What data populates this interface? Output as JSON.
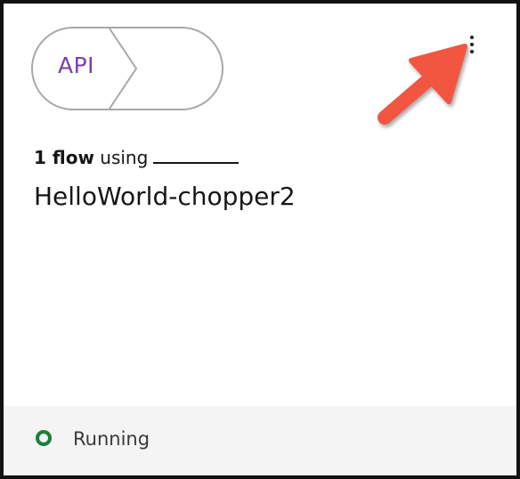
{
  "connector": {
    "label": "API"
  },
  "menu": {
    "icon": "overflow-menu-vertical-icon"
  },
  "annotation": {
    "icon": "arrow-pointer-icon",
    "color": "#f2553f"
  },
  "flow": {
    "count_label": "1 flow",
    "using_label": "using"
  },
  "integration": {
    "name": "HelloWorld-chopper2"
  },
  "status": {
    "icon": "running-status-circle-icon",
    "label": "Running",
    "color": "#198038"
  },
  "colors": {
    "connector_text": "#7b3fa6",
    "footer_bg": "#f4f4f4",
    "border": "#111111"
  }
}
